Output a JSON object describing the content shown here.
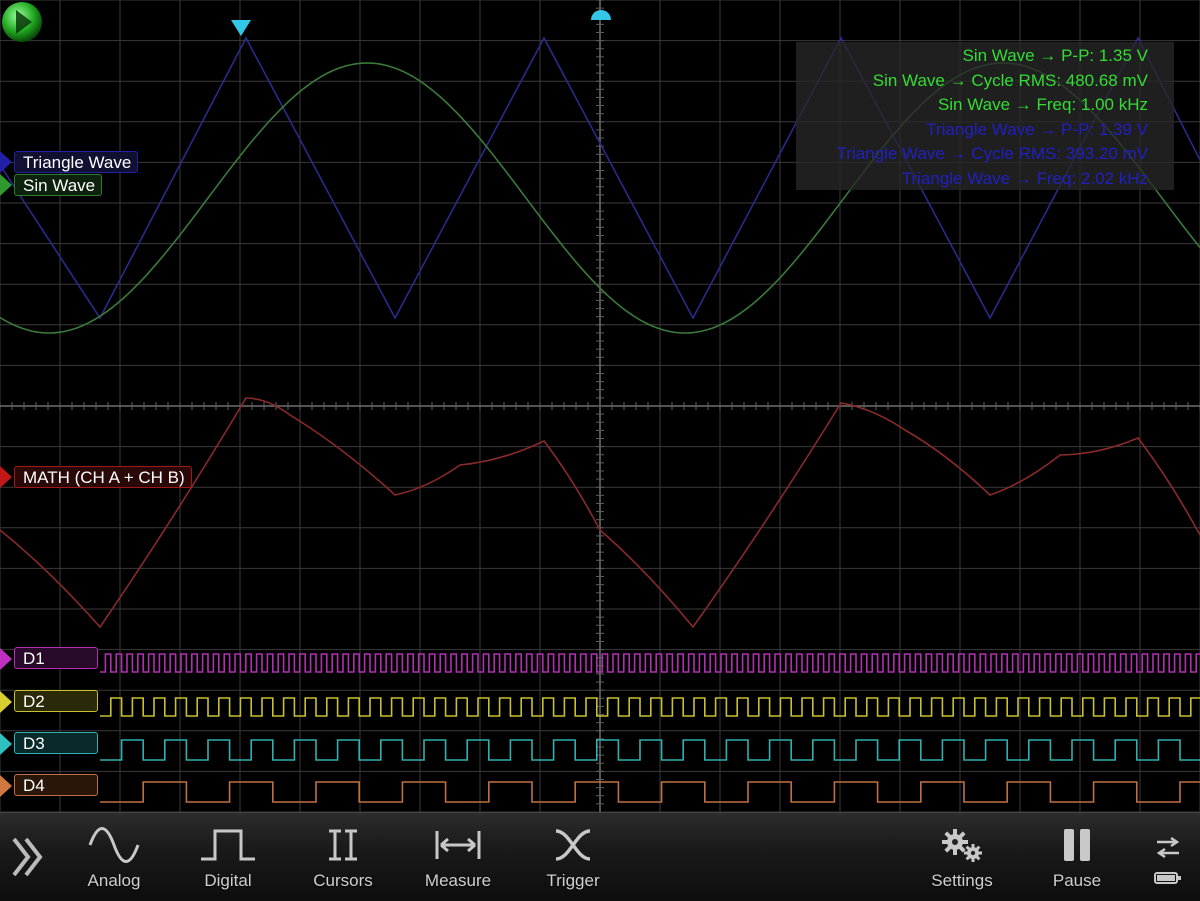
{
  "channels": {
    "triangle": {
      "label": "Triangle Wave",
      "color": "#2020a8",
      "trace_color": "#2a2a8c"
    },
    "sine": {
      "label": "Sin Wave",
      "color": "#2e7d2e",
      "trace_color": "#3a7a3a"
    },
    "math": {
      "label": "MATH (CH A + CH B)",
      "color": "#a01818",
      "trace_color": "#8a2a2a"
    },
    "digital": [
      {
        "label": "D1",
        "color": "#b030b0"
      },
      {
        "label": "D2",
        "color": "#c8c030"
      },
      {
        "label": "D3",
        "color": "#30b0b0"
      },
      {
        "label": "D4",
        "color": "#c07040"
      }
    ]
  },
  "measurements": [
    {
      "text": "Sin Wave → P-P: 1.35 V",
      "color": "#33dd33"
    },
    {
      "text": "Sin Wave → Cycle RMS: 480.68 mV",
      "color": "#33dd33"
    },
    {
      "text": "Sin Wave → Freq: 1.00 kHz",
      "color": "#33dd33"
    },
    {
      "text": "Triangle Wave → P-P: 1.39 V",
      "color": "#2020c0"
    },
    {
      "text": "Triangle Wave → Cycle RMS: 393.20 mV",
      "color": "#2020c0"
    },
    {
      "text": "Triangle Wave → Freq: 2.02 kHz",
      "color": "#2020c0"
    }
  ],
  "toolbar": {
    "expand_icon": "double-chevron-right-icon",
    "analog": "Analog",
    "digital": "Digital",
    "cursors": "Cursors",
    "measure": "Measure",
    "trigger": "Trigger",
    "settings": "Settings",
    "pause": "Pause"
  },
  "colors": {
    "trigger_marker": "#33c8e8",
    "grid": "#3a3a3a",
    "background": "#000000"
  }
}
